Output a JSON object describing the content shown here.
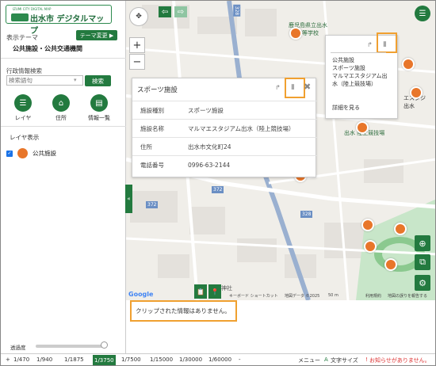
{
  "logo": {
    "subtitle": "IZUMI CITY DIGITAL MAP",
    "title": "出水市 デジタルマップ"
  },
  "sidebar": {
    "theme_label": "表示テーマ",
    "theme_change_button": "テーマ変更 ▶",
    "theme_name": "公共施設・公共交通機関",
    "search_label": "行政情報検索",
    "search_placeholder": "検索語句",
    "search_button": "検索",
    "tools": [
      {
        "icon": "list-icon",
        "label": "レイヤ"
      },
      {
        "icon": "home-icon",
        "label": "住所"
      },
      {
        "icon": "table-icon",
        "label": "情報一覧"
      }
    ],
    "layer_heading": "レイヤ表示",
    "layers": [
      {
        "label": "公共施設",
        "checked": true
      }
    ],
    "opacity_label": "透過度",
    "opacity_value": 1.0
  },
  "popup_main": {
    "title": "スポーツ施設",
    "rows": [
      {
        "key": "施設種別",
        "value": "スポーツ施設"
      },
      {
        "key": "施設名称",
        "value": "マルマエスタジアム出水（陸上競技場）"
      },
      {
        "key": "住所",
        "value": "出水市文化町24"
      },
      {
        "key": "電話番号",
        "value": "0996-63-2144"
      }
    ]
  },
  "popup_small": {
    "lines": [
      "公共施設",
      "スポーツ施設",
      "マルマエスタジアム出",
      "水（陸上競技場）"
    ],
    "detail_link": "詳細を見る"
  },
  "map": {
    "labels": {
      "school": "鹿児島県立出水",
      "school2": "高等学校",
      "stadium": "出水 陸上競技場",
      "route328": "328",
      "route372": "372",
      "shrine": "神社",
      "izumi_partial": "出水",
      "partial_e": "エスタジ"
    },
    "credits": [
      "キーボード ショートカット",
      "地図データ ©2025",
      "50 m",
      "利用規約",
      "地図の誤りを報告する"
    ],
    "google": "Google"
  },
  "clip_message": "クリップされた情報はありません。",
  "bottom": {
    "scales": [
      "1/470",
      "1/940",
      "1/1875",
      "1/3750",
      "1/7500",
      "1/15000",
      "1/30000",
      "1/60000"
    ],
    "active_scale": "1/3750",
    "menu": "メニュー",
    "text_size": "文字サイズ",
    "no_alert": "お知らせがありません。"
  },
  "colors": {
    "accent": "#237a3f",
    "highlight": "#f0a030",
    "marker": "#e8762a"
  }
}
